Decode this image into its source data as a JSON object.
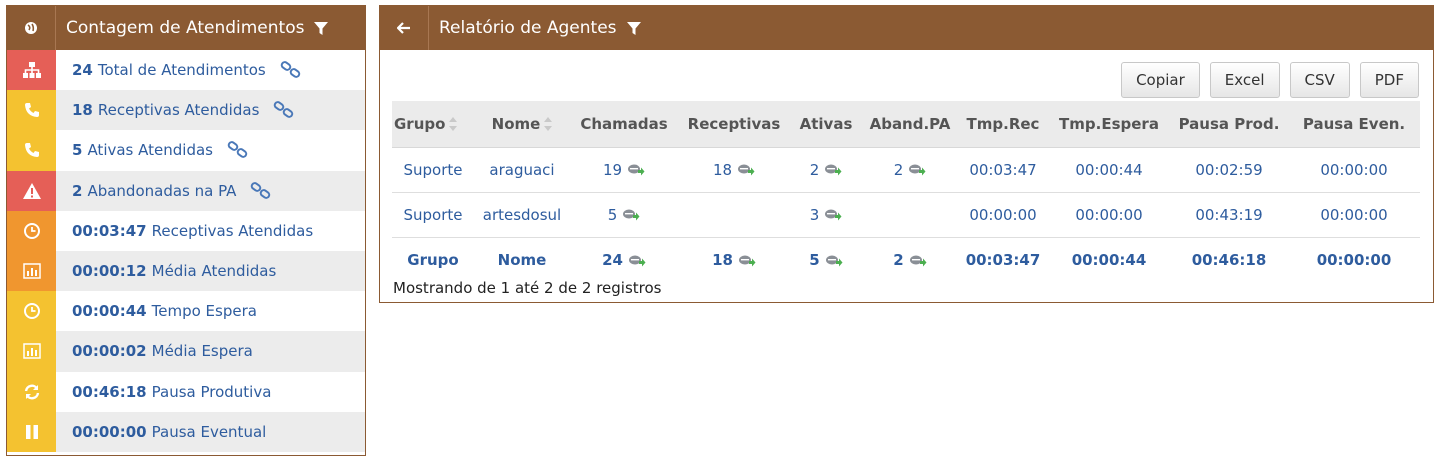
{
  "left": {
    "title": "Contagem de Atendimentos",
    "rows": [
      {
        "value": "24",
        "label": "Total de Atendimentos",
        "color": "#e55f57",
        "icon": "sitemap-icon",
        "link": true
      },
      {
        "value": "18",
        "label": "Receptivas Atendidas",
        "color": "#f4c230",
        "icon": "phone-icon",
        "link": true
      },
      {
        "value": "5",
        "label": "Ativas Atendidas",
        "color": "#f4c230",
        "icon": "phone-icon",
        "link": true
      },
      {
        "value": "2",
        "label": "Abandonadas na PA",
        "color": "#e55f57",
        "icon": "warning-icon",
        "link": true
      },
      {
        "value": "00:03:47",
        "label": "Receptivas Atendidas",
        "color": "#f0962f",
        "icon": "clock-icon",
        "link": false
      },
      {
        "value": "00:00:12",
        "label": "Média Atendidas",
        "color": "#f0962f",
        "icon": "bar-chart-icon",
        "link": false
      },
      {
        "value": "00:00:44",
        "label": "Tempo Espera",
        "color": "#f4c230",
        "icon": "clock-icon",
        "link": false
      },
      {
        "value": "00:00:02",
        "label": "Média Espera",
        "color": "#f4c230",
        "icon": "bar-chart-icon",
        "link": false
      },
      {
        "value": "00:46:18",
        "label": "Pausa Produtiva",
        "color": "#f4c230",
        "icon": "refresh-icon",
        "link": false
      },
      {
        "value": "00:00:00",
        "label": "Pausa Eventual",
        "color": "#f4c230",
        "icon": "pause-icon",
        "link": false
      }
    ]
  },
  "right": {
    "title": "Relatório de Agentes",
    "buttons": [
      "Copiar",
      "Excel",
      "CSV",
      "PDF"
    ],
    "columns": [
      "Grupo",
      "Nome",
      "Chamadas",
      "Receptivas",
      "Ativas",
      "Aband.PA",
      "Tmp.Rec",
      "Tmp.Espera",
      "Pausa Prod.",
      "Pausa Even."
    ],
    "rows": [
      [
        "Suporte",
        "araguaci",
        "19",
        "18",
        "2",
        "2",
        "00:03:47",
        "00:00:44",
        "00:02:59",
        "00:00:00"
      ],
      [
        "Suporte",
        "artesdosul",
        "5",
        "",
        "3",
        "",
        "00:00:00",
        "00:00:00",
        "00:43:19",
        "00:00:00"
      ]
    ],
    "footer": [
      "Grupo",
      "Nome",
      "24",
      "18",
      "5",
      "2",
      "00:03:47",
      "00:00:44",
      "00:46:18",
      "00:00:00"
    ],
    "info": "Mostrando de 1 até 2 de 2 registros"
  },
  "colors": {
    "header_brown": "#8b5a33",
    "link_blue": "#2e5c9e",
    "icon_green": "#4caf50"
  }
}
